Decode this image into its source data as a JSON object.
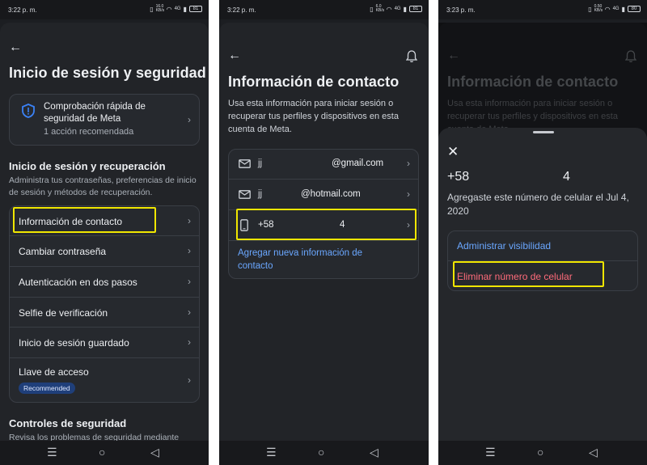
{
  "status": {
    "time1": "3:22 p. m.",
    "time2": "3:22 p. m.",
    "time3": "3:23 p. m.",
    "battery1": "81",
    "battery2": "81",
    "battery3": "80",
    "signal": "4G",
    "data_speed1": "16.0 KB/s",
    "data_speed2": "6.0 KB/s",
    "data_speed3": "0.50 KB/s"
  },
  "screen1": {
    "title": "Inicio de sesión y seguridad",
    "quick_check": {
      "title": "Comprobación rápida de seguridad de Meta",
      "subtitle": "1 acción recomendada"
    },
    "section1": {
      "heading": "Inicio de sesión y recuperación",
      "description": "Administra tus contraseñas, preferencias de inicio de sesión y métodos de recuperación."
    },
    "items": [
      {
        "label": "Información de contacto"
      },
      {
        "label": "Cambiar contraseña"
      },
      {
        "label": "Autenticación en dos pasos"
      },
      {
        "label": "Selfie de verificación"
      },
      {
        "label": "Inicio de sesión guardado"
      },
      {
        "label": "Llave de acceso",
        "badge": "Recommended"
      }
    ],
    "section2": {
      "heading": "Controles de seguridad",
      "description": "Revisa los problemas de seguridad mediante"
    }
  },
  "screen2": {
    "title": "Información de contacto",
    "description": "Usa esta información para iniciar sesión o recuperar tus perfiles y dispositivos en esta cuenta de Meta.",
    "contacts": [
      {
        "prefix": "jj",
        "value": "@gmail.com",
        "icon": "mail-icon"
      },
      {
        "prefix": "jj",
        "value": "@hotmail.com",
        "icon": "mail-icon"
      },
      {
        "prefix": "+58",
        "value": "4",
        "icon": "phone-icon"
      }
    ],
    "add_link": "Agregar nueva información de contacto"
  },
  "screen3": {
    "bg_title": "Información de contacto",
    "bg_description": "Usa esta información para iniciar sesión o recuperar tus perfiles y dispositivos en esta cuenta de Meta.",
    "number_prefix": "+58",
    "number_suffix": "4",
    "added_text": "Agregaste este número de celular el Jul 4, 2020",
    "actions": [
      {
        "label": "Administrar visibilidad",
        "color": "#6aa7ff"
      },
      {
        "label": "Eliminar número de celular",
        "color": "#ff6b7a"
      }
    ]
  },
  "navbar": {
    "menu_glyph": "☰",
    "home_glyph": "○",
    "back_glyph": "◁"
  },
  "colors": {
    "highlight": "#f0e600",
    "link": "#6aa7ff",
    "danger": "#ff6b7a",
    "badge": "#1f3f7a"
  }
}
